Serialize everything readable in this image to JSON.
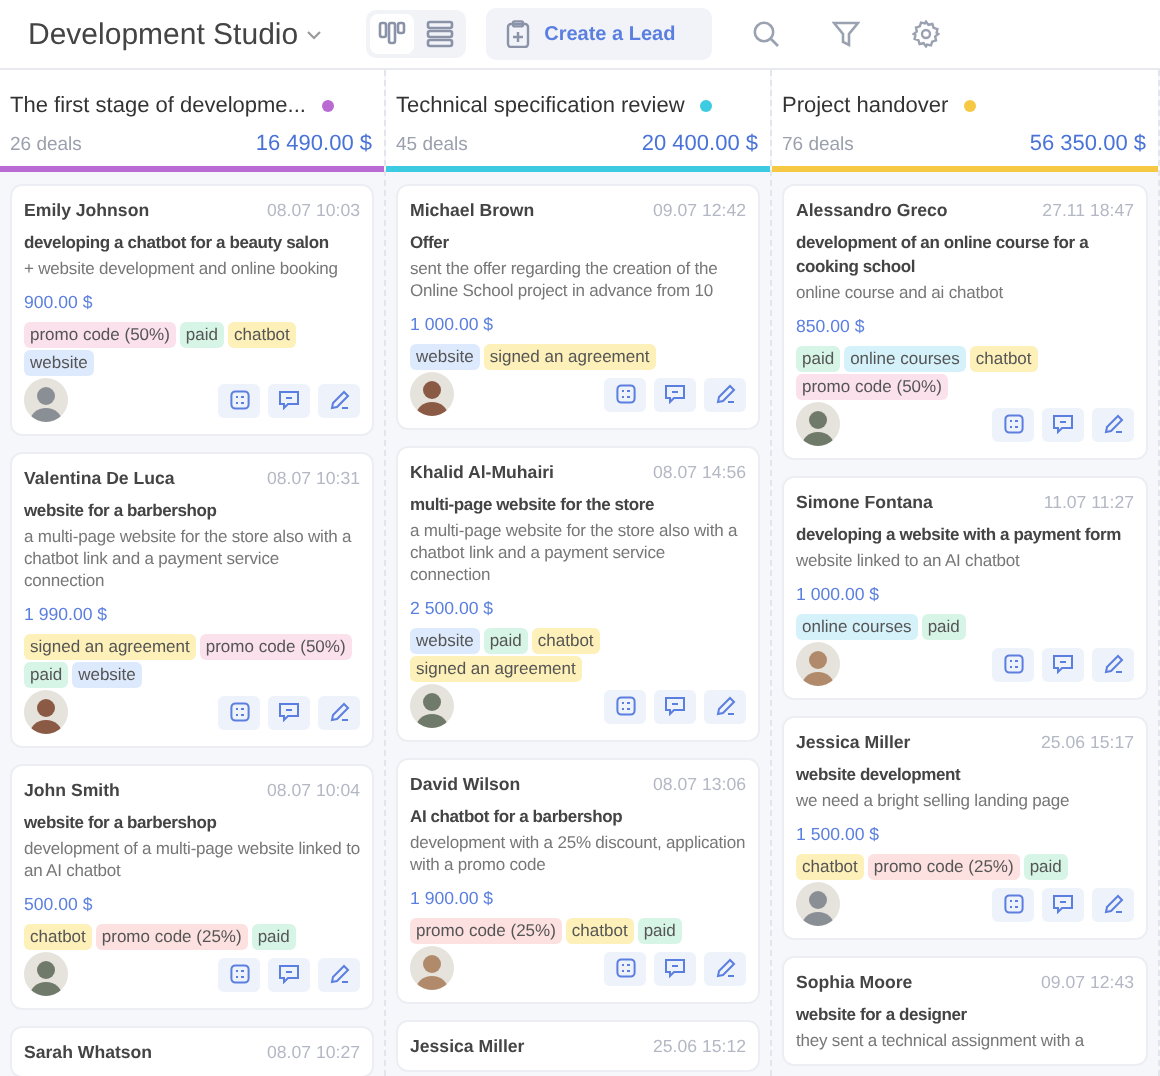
{
  "toolbar": {
    "workspace": "Development Studio",
    "views": [
      {
        "kind": "board",
        "selected": true
      },
      {
        "kind": "list",
        "selected": false
      }
    ],
    "create_button": "Create a Lead"
  },
  "columns": [
    {
      "title": "The first stage of developme...",
      "color": "#b96ad3",
      "deals": "26 deals",
      "total": "16 490.00 $",
      "cards": [
        {
          "name": "Emily Johnson",
          "time": "08.07 10:03",
          "title": "developing a chatbot for a beauty salon",
          "description": "+ website development and online booking",
          "amount": "900.00 $",
          "tags": [
            {
              "label": "promo code (50%)",
              "color": "#fbe1ec"
            },
            {
              "label": "paid",
              "color": "#d7f5e6"
            },
            {
              "label": "chatbot",
              "color": "#fdf0b8"
            },
            {
              "label": "website",
              "color": "#dde9fc"
            }
          ]
        },
        {
          "name": "Valentina De Luca",
          "time": "08.07 10:31",
          "title": "website for a barbershop",
          "description": "a multi-page website for the store also with a chatbot link and a payment service connection",
          "amount": "1 990.00 $",
          "tags": [
            {
              "label": "signed an agreement",
              "color": "#fdf0b8"
            },
            {
              "label": "promo code (50%)",
              "color": "#fbe1ec"
            },
            {
              "label": "paid",
              "color": "#d7f5e6"
            },
            {
              "label": "website",
              "color": "#dde9fc"
            }
          ]
        },
        {
          "name": "John Smith",
          "time": "08.07 10:04",
          "title": "website for a barbershop",
          "description": "development of a multi-page website linked to an AI chatbot",
          "amount": "500.00 $",
          "tags": [
            {
              "label": "chatbot",
              "color": "#fdf0b8"
            },
            {
              "label": "promo code (25%)",
              "color": "#fde0e0"
            },
            {
              "label": "paid",
              "color": "#d7f5e6"
            }
          ]
        },
        {
          "name": "Sarah Whatson",
          "time": "08.07 10:27"
        }
      ]
    },
    {
      "title": "Technical specification review",
      "color": "#3ccbe0",
      "deals": "45 deals",
      "total": "20 400.00 $",
      "cards": [
        {
          "name": "Michael Brown",
          "time": "09.07 12:42",
          "title": "Offer",
          "description": "sent the offer regarding the creation of the Online School project in advance from 10",
          "amount": "1 000.00 $",
          "tags": [
            {
              "label": "website",
              "color": "#dde9fc"
            },
            {
              "label": "signed an agreement",
              "color": "#fdf0b8"
            }
          ]
        },
        {
          "name": "Khalid Al-Muhairi",
          "time": "08.07 14:56",
          "title": "multi-page website for the store",
          "description": "a multi-page website for the store also with a chatbot link and a payment service connection",
          "amount": "2 500.00 $",
          "tags": [
            {
              "label": "website",
              "color": "#dde9fc"
            },
            {
              "label": "paid",
              "color": "#d7f5e6"
            },
            {
              "label": "chatbot",
              "color": "#fdf0b8"
            },
            {
              "label": "signed an agreement",
              "color": "#fdf0b8"
            }
          ]
        },
        {
          "name": "David Wilson",
          "time": "08.07 13:06",
          "title": "AI chatbot for a barbershop",
          "description": "development with a 25% discount, application with a promo code",
          "amount": "1 900.00 $",
          "tags": [
            {
              "label": "promo code (25%)",
              "color": "#fde0e0"
            },
            {
              "label": "chatbot",
              "color": "#fdf0b8"
            },
            {
              "label": "paid",
              "color": "#d7f5e6"
            }
          ]
        },
        {
          "name": "Jessica Miller",
          "time": "25.06 15:12"
        }
      ]
    },
    {
      "title": "Project handover",
      "color": "#f7c843",
      "deals": "76 deals",
      "total": "56 350.00 $",
      "cards": [
        {
          "name": "Alessandro Greco",
          "time": "27.11 18:47",
          "title": "development of an online course for a cooking school",
          "description": "online course and ai chatbot",
          "amount": "850.00 $",
          "tags": [
            {
              "label": "paid",
              "color": "#d7f5e6"
            },
            {
              "label": "online courses",
              "color": "#d5f2fb"
            },
            {
              "label": "chatbot",
              "color": "#fdf0b8"
            },
            {
              "label": "promo code (50%)",
              "color": "#fbe1ec"
            }
          ]
        },
        {
          "name": "Simone Fontana",
          "time": "11.07 11:27",
          "title": "developing a website with a payment form",
          "description": "website linked to an AI chatbot",
          "amount": "1 000.00 $",
          "tags": [
            {
              "label": "online courses",
              "color": "#d5f2fb"
            },
            {
              "label": "paid",
              "color": "#d7f5e6"
            }
          ]
        },
        {
          "name": "Jessica Miller",
          "time": "25.06 15:17",
          "title": "website development",
          "description": "we need a bright selling landing page",
          "amount": "1 500.00 $",
          "tags": [
            {
              "label": "chatbot",
              "color": "#fdf0b8"
            },
            {
              "label": "promo code (25%)",
              "color": "#fde0e0"
            },
            {
              "label": "paid",
              "color": "#d7f5e6"
            }
          ]
        },
        {
          "name": "Sophia Moore",
          "time": "09.07 12:43",
          "title": "website for a designer",
          "description": "they sent a technical assignment with a"
        }
      ]
    }
  ]
}
